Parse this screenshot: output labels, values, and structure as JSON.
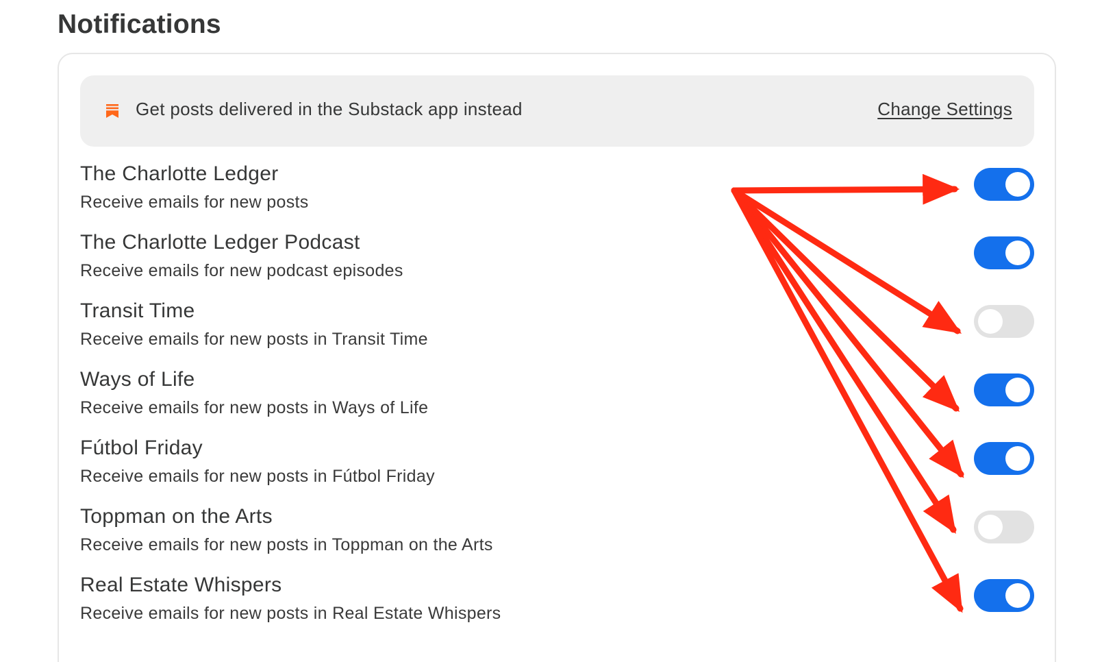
{
  "header": {
    "title": "Notifications"
  },
  "banner": {
    "icon": "substack-bookmark-icon",
    "text": "Get posts delivered in the Substack app instead",
    "link_label": "Change Settings"
  },
  "subscriptions": [
    {
      "title": "The Charlotte Ledger",
      "subtitle": "Receive emails for new posts",
      "enabled": true
    },
    {
      "title": "The Charlotte Ledger Podcast",
      "subtitle": "Receive emails for new podcast episodes",
      "enabled": true
    },
    {
      "title": "Transit Time",
      "subtitle": "Receive emails for new posts in Transit Time",
      "enabled": false
    },
    {
      "title": "Ways of Life",
      "subtitle": "Receive emails for new posts in Ways of Life",
      "enabled": true
    },
    {
      "title": "Fútbol Friday",
      "subtitle": "Receive emails for new posts in Fútbol Friday",
      "enabled": true
    },
    {
      "title": "Toppman on the Arts",
      "subtitle": "Receive emails for new posts in Toppman on the Arts",
      "enabled": false
    },
    {
      "title": "Real Estate Whispers",
      "subtitle": "Receive emails for new posts in Real Estate Whispers",
      "enabled": true
    }
  ],
  "colors": {
    "toggle_on": "#1470ec",
    "toggle_off": "#e2e2e2",
    "annotation_arrow": "#ff2a12",
    "substack_brand": "#ff6719"
  }
}
